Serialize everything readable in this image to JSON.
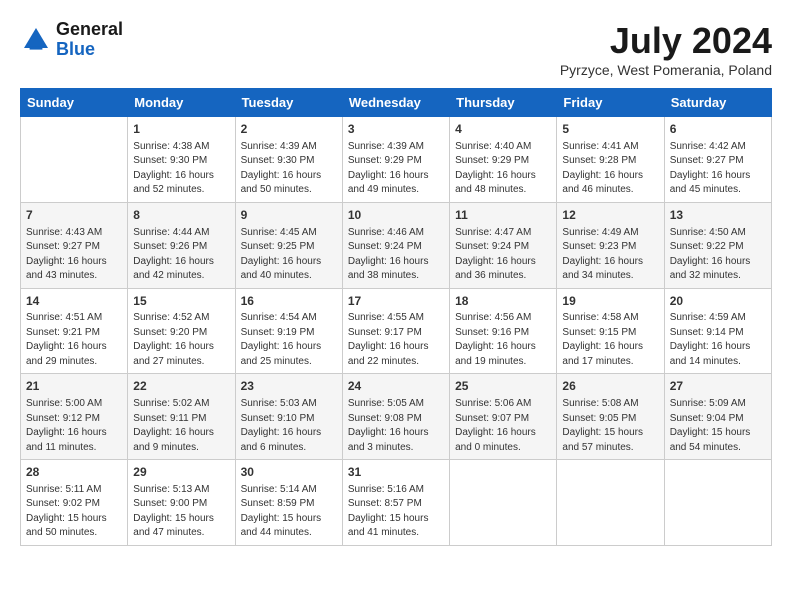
{
  "header": {
    "logo": {
      "line1": "General",
      "line2": "Blue"
    },
    "title": "July 2024",
    "subtitle": "Pyrzyce, West Pomerania, Poland"
  },
  "days_of_week": [
    "Sunday",
    "Monday",
    "Tuesday",
    "Wednesday",
    "Thursday",
    "Friday",
    "Saturday"
  ],
  "weeks": [
    [
      {
        "day": "",
        "sunrise": "",
        "sunset": "",
        "daylight": ""
      },
      {
        "day": "1",
        "sunrise": "Sunrise: 4:38 AM",
        "sunset": "Sunset: 9:30 PM",
        "daylight": "Daylight: 16 hours and 52 minutes."
      },
      {
        "day": "2",
        "sunrise": "Sunrise: 4:39 AM",
        "sunset": "Sunset: 9:30 PM",
        "daylight": "Daylight: 16 hours and 50 minutes."
      },
      {
        "day": "3",
        "sunrise": "Sunrise: 4:39 AM",
        "sunset": "Sunset: 9:29 PM",
        "daylight": "Daylight: 16 hours and 49 minutes."
      },
      {
        "day": "4",
        "sunrise": "Sunrise: 4:40 AM",
        "sunset": "Sunset: 9:29 PM",
        "daylight": "Daylight: 16 hours and 48 minutes."
      },
      {
        "day": "5",
        "sunrise": "Sunrise: 4:41 AM",
        "sunset": "Sunset: 9:28 PM",
        "daylight": "Daylight: 16 hours and 46 minutes."
      },
      {
        "day": "6",
        "sunrise": "Sunrise: 4:42 AM",
        "sunset": "Sunset: 9:27 PM",
        "daylight": "Daylight: 16 hours and 45 minutes."
      }
    ],
    [
      {
        "day": "7",
        "sunrise": "Sunrise: 4:43 AM",
        "sunset": "Sunset: 9:27 PM",
        "daylight": "Daylight: 16 hours and 43 minutes."
      },
      {
        "day": "8",
        "sunrise": "Sunrise: 4:44 AM",
        "sunset": "Sunset: 9:26 PM",
        "daylight": "Daylight: 16 hours and 42 minutes."
      },
      {
        "day": "9",
        "sunrise": "Sunrise: 4:45 AM",
        "sunset": "Sunset: 9:25 PM",
        "daylight": "Daylight: 16 hours and 40 minutes."
      },
      {
        "day": "10",
        "sunrise": "Sunrise: 4:46 AM",
        "sunset": "Sunset: 9:24 PM",
        "daylight": "Daylight: 16 hours and 38 minutes."
      },
      {
        "day": "11",
        "sunrise": "Sunrise: 4:47 AM",
        "sunset": "Sunset: 9:24 PM",
        "daylight": "Daylight: 16 hours and 36 minutes."
      },
      {
        "day": "12",
        "sunrise": "Sunrise: 4:49 AM",
        "sunset": "Sunset: 9:23 PM",
        "daylight": "Daylight: 16 hours and 34 minutes."
      },
      {
        "day": "13",
        "sunrise": "Sunrise: 4:50 AM",
        "sunset": "Sunset: 9:22 PM",
        "daylight": "Daylight: 16 hours and 32 minutes."
      }
    ],
    [
      {
        "day": "14",
        "sunrise": "Sunrise: 4:51 AM",
        "sunset": "Sunset: 9:21 PM",
        "daylight": "Daylight: 16 hours and 29 minutes."
      },
      {
        "day": "15",
        "sunrise": "Sunrise: 4:52 AM",
        "sunset": "Sunset: 9:20 PM",
        "daylight": "Daylight: 16 hours and 27 minutes."
      },
      {
        "day": "16",
        "sunrise": "Sunrise: 4:54 AM",
        "sunset": "Sunset: 9:19 PM",
        "daylight": "Daylight: 16 hours and 25 minutes."
      },
      {
        "day": "17",
        "sunrise": "Sunrise: 4:55 AM",
        "sunset": "Sunset: 9:17 PM",
        "daylight": "Daylight: 16 hours and 22 minutes."
      },
      {
        "day": "18",
        "sunrise": "Sunrise: 4:56 AM",
        "sunset": "Sunset: 9:16 PM",
        "daylight": "Daylight: 16 hours and 19 minutes."
      },
      {
        "day": "19",
        "sunrise": "Sunrise: 4:58 AM",
        "sunset": "Sunset: 9:15 PM",
        "daylight": "Daylight: 16 hours and 17 minutes."
      },
      {
        "day": "20",
        "sunrise": "Sunrise: 4:59 AM",
        "sunset": "Sunset: 9:14 PM",
        "daylight": "Daylight: 16 hours and 14 minutes."
      }
    ],
    [
      {
        "day": "21",
        "sunrise": "Sunrise: 5:00 AM",
        "sunset": "Sunset: 9:12 PM",
        "daylight": "Daylight: 16 hours and 11 minutes."
      },
      {
        "day": "22",
        "sunrise": "Sunrise: 5:02 AM",
        "sunset": "Sunset: 9:11 PM",
        "daylight": "Daylight: 16 hours and 9 minutes."
      },
      {
        "day": "23",
        "sunrise": "Sunrise: 5:03 AM",
        "sunset": "Sunset: 9:10 PM",
        "daylight": "Daylight: 16 hours and 6 minutes."
      },
      {
        "day": "24",
        "sunrise": "Sunrise: 5:05 AM",
        "sunset": "Sunset: 9:08 PM",
        "daylight": "Daylight: 16 hours and 3 minutes."
      },
      {
        "day": "25",
        "sunrise": "Sunrise: 5:06 AM",
        "sunset": "Sunset: 9:07 PM",
        "daylight": "Daylight: 16 hours and 0 minutes."
      },
      {
        "day": "26",
        "sunrise": "Sunrise: 5:08 AM",
        "sunset": "Sunset: 9:05 PM",
        "daylight": "Daylight: 15 hours and 57 minutes."
      },
      {
        "day": "27",
        "sunrise": "Sunrise: 5:09 AM",
        "sunset": "Sunset: 9:04 PM",
        "daylight": "Daylight: 15 hours and 54 minutes."
      }
    ],
    [
      {
        "day": "28",
        "sunrise": "Sunrise: 5:11 AM",
        "sunset": "Sunset: 9:02 PM",
        "daylight": "Daylight: 15 hours and 50 minutes."
      },
      {
        "day": "29",
        "sunrise": "Sunrise: 5:13 AM",
        "sunset": "Sunset: 9:00 PM",
        "daylight": "Daylight: 15 hours and 47 minutes."
      },
      {
        "day": "30",
        "sunrise": "Sunrise: 5:14 AM",
        "sunset": "Sunset: 8:59 PM",
        "daylight": "Daylight: 15 hours and 44 minutes."
      },
      {
        "day": "31",
        "sunrise": "Sunrise: 5:16 AM",
        "sunset": "Sunset: 8:57 PM",
        "daylight": "Daylight: 15 hours and 41 minutes."
      },
      {
        "day": "",
        "sunrise": "",
        "sunset": "",
        "daylight": ""
      },
      {
        "day": "",
        "sunrise": "",
        "sunset": "",
        "daylight": ""
      },
      {
        "day": "",
        "sunrise": "",
        "sunset": "",
        "daylight": ""
      }
    ]
  ]
}
